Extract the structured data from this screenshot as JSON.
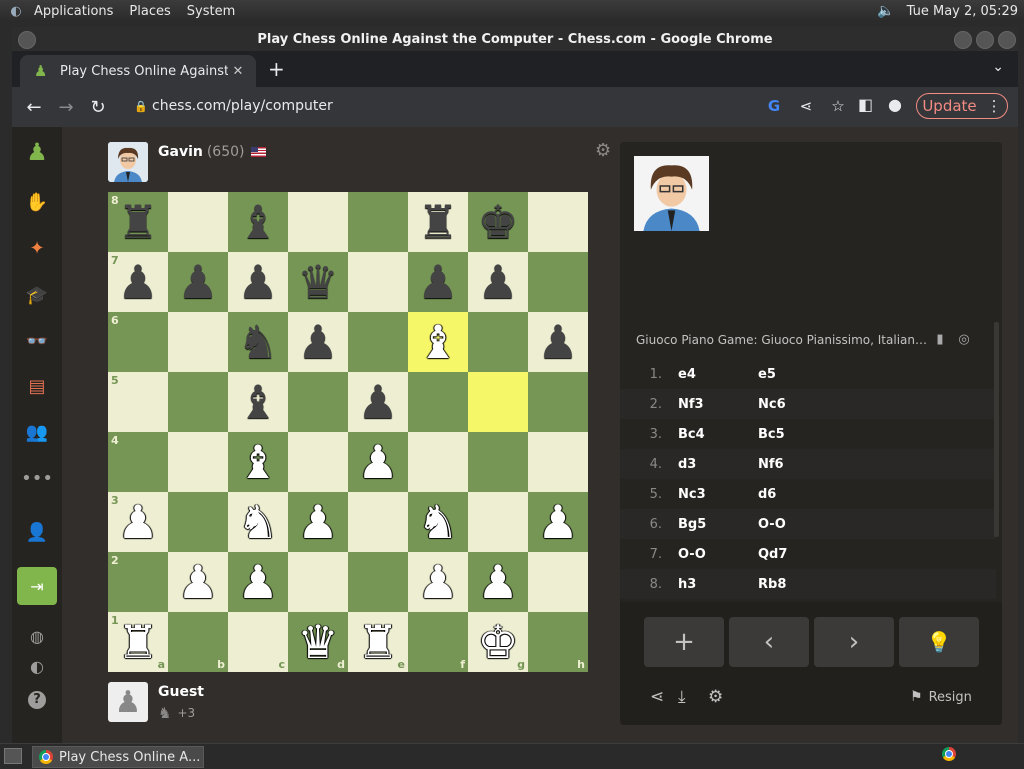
{
  "top_panel": {
    "menus": [
      "Applications",
      "Places",
      "System"
    ],
    "clock": "Tue May  2, 05:29"
  },
  "window": {
    "title": "Play Chess Online Against the Computer - Chess.com - Google Chrome"
  },
  "tab": {
    "title": "Play Chess Online Against"
  },
  "toolbar": {
    "url": "chess.com/play/computer",
    "update_label": "Update"
  },
  "opponent": {
    "name": "Gavin",
    "rating": "(650)"
  },
  "player": {
    "name": "Guest",
    "advantage": "+3"
  },
  "board": {
    "light_color": "#eeeed2",
    "dark_color": "#769656",
    "highlight": [
      "f6",
      "g5"
    ],
    "position": {
      "a8": "bR",
      "c8": "bB",
      "f8": "bR",
      "g8": "bK",
      "a7": "bP",
      "b7": "bP",
      "c7": "bP",
      "d7": "bQ",
      "f7": "bP",
      "g7": "bP",
      "c6": "bN",
      "d6": "bP",
      "f6": "wB",
      "h6": "bP",
      "c5": "bB",
      "e5": "bP",
      "c4": "wB",
      "e4": "wP",
      "a3": "wP",
      "c3": "wN",
      "d3": "wP",
      "f3": "wN",
      "h3": "wP",
      "b2": "wP",
      "c2": "wP",
      "f2": "wP",
      "g2": "wP",
      "a1": "wR",
      "d1": "wQ",
      "e1": "wR",
      "g1": "wK"
    }
  },
  "opening": "Giuoco Piano Game: Giuoco Pianissimo, Italian Four Knights Variation",
  "moves": [
    {
      "n": "1.",
      "w": "e4",
      "b": "e5"
    },
    {
      "n": "2.",
      "w": "Nf3",
      "b": "Nc6"
    },
    {
      "n": "3.",
      "w": "Bc4",
      "b": "Bc5"
    },
    {
      "n": "4.",
      "w": "d3",
      "b": "Nf6"
    },
    {
      "n": "5.",
      "w": "Nc3",
      "b": "d6"
    },
    {
      "n": "6.",
      "w": "Bg5",
      "b": "O-O"
    },
    {
      "n": "7.",
      "w": "O-O",
      "b": "Qd7"
    },
    {
      "n": "8.",
      "w": "h3",
      "b": "Rb8"
    }
  ],
  "controls": {
    "resign_label": "Resign"
  },
  "taskbar": {
    "item_label": "Play Chess Online A..."
  }
}
